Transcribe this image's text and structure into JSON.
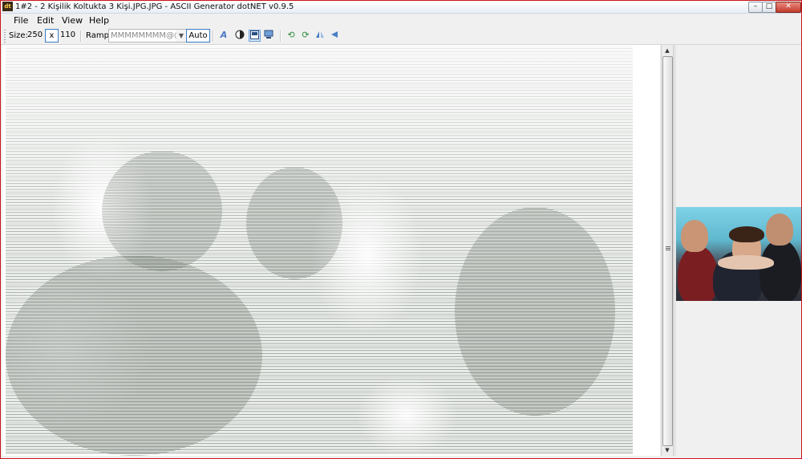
{
  "window": {
    "title": "1#2 - 2 Kişilik Koltukta 3 Kişi.JPG.JPG - ASCII Generator dotNET v0.9.5",
    "app_icon": "ascii-generator-app-icon",
    "accent_color": "#c9151b"
  },
  "menu": {
    "file": "File",
    "edit": "Edit",
    "view": "View",
    "help": "Help"
  },
  "toolbar": {
    "size_label": "Size:",
    "width": "250",
    "x_label": "x",
    "height": "110",
    "ramp_label": "Ramp:",
    "ramp_value": "MMMMMMMM@@",
    "auto_label": "Auto",
    "icons": [
      "font-icon",
      "invert-icon",
      "black-on-white-icon",
      "save-image-icon",
      "rotate-left-icon",
      "rotate-right-icon",
      "flip-horizontal-icon",
      "flip-vertical-icon"
    ]
  },
  "preview": {
    "description_icon": "source-photo-thumbnail"
  }
}
